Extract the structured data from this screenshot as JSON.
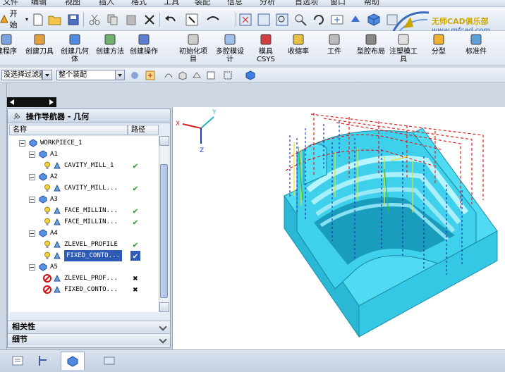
{
  "menu": [
    "文件",
    "编辑",
    "视图",
    "插入",
    "格式",
    "工具",
    "装配",
    "信息",
    "分析",
    "首选项",
    "窗口",
    "帮助"
  ],
  "start_label": "开始",
  "logo": {
    "text": "无师CAD俱乐部",
    "url": "www.mfcad.com"
  },
  "tools": [
    {
      "label": "建程序",
      "icon": "create-program-icon"
    },
    {
      "label": "创建刀具",
      "icon": "create-tool-icon"
    },
    {
      "label": "创建几何\n体",
      "icon": "create-geometry-icon"
    },
    {
      "label": "创建方法",
      "icon": "create-method-icon"
    },
    {
      "label": "创建操作",
      "icon": "create-operation-icon"
    },
    {
      "label": "初始化项\n目",
      "icon": "init-project-icon"
    },
    {
      "label": "多腔模设\n计",
      "icon": "multi-cavity-icon"
    },
    {
      "label": "模具\nCSYS",
      "icon": "mold-csys-icon"
    },
    {
      "label": "收缩率",
      "icon": "shrinkage-icon"
    },
    {
      "label": "工件",
      "icon": "workpiece-icon"
    },
    {
      "label": "型腔布局",
      "icon": "cavity-layout-icon"
    },
    {
      "label": "注塑模工\n具",
      "icon": "injection-tool-icon"
    },
    {
      "label": "分型",
      "icon": "parting-icon"
    },
    {
      "label": "标准件",
      "icon": "standard-parts-icon"
    }
  ],
  "filters": {
    "selection_filter": "没选择过滤器",
    "assembly": "整个装配"
  },
  "navigator": {
    "title": "操作导航器 - 几何",
    "col_name": "名称",
    "col_path": "路径",
    "rows": [
      {
        "text": "WORKPIECE_1",
        "kind": "group",
        "indent": 0,
        "status": ""
      },
      {
        "text": "A1",
        "kind": "group",
        "indent": 1,
        "status": ""
      },
      {
        "text": "CAVITY_MILL_1",
        "kind": "op",
        "indent": 2,
        "status": "ok"
      },
      {
        "text": "A2",
        "kind": "group",
        "indent": 1,
        "status": ""
      },
      {
        "text": "CAVITY_MILL...",
        "kind": "op",
        "indent": 2,
        "status": "ok"
      },
      {
        "text": "A3",
        "kind": "group",
        "indent": 1,
        "status": ""
      },
      {
        "text": "FACE_MILLIN...",
        "kind": "op",
        "indent": 2,
        "status": "ok"
      },
      {
        "text": "FACE_MILLIN...",
        "kind": "op",
        "indent": 2,
        "status": "ok"
      },
      {
        "text": "A4",
        "kind": "group",
        "indent": 1,
        "status": ""
      },
      {
        "text": "ZLEVEL_PROFILE",
        "kind": "op",
        "indent": 2,
        "status": "ok"
      },
      {
        "text": "FIXED_CONTO...",
        "kind": "op",
        "indent": 2,
        "status": "ok",
        "selected": true
      },
      {
        "text": "A5",
        "kind": "group",
        "indent": 1,
        "status": ""
      },
      {
        "text": "ZLEVEL_PROF...",
        "kind": "op",
        "indent": 2,
        "status": "bad"
      },
      {
        "text": "FIXED_CONTO...",
        "kind": "op",
        "indent": 2,
        "status": "bad"
      }
    ],
    "sections": [
      "相关性",
      "细节"
    ]
  },
  "axes": {
    "x": "X",
    "y": "Y",
    "z": "Z"
  },
  "colors": {
    "model": "#46d9f0",
    "toolpath_red": "#e02020",
    "toolpath_blue": "#1f35b8",
    "toolpath_yellow": "#e8e020",
    "selection": "#2f5bb6"
  }
}
